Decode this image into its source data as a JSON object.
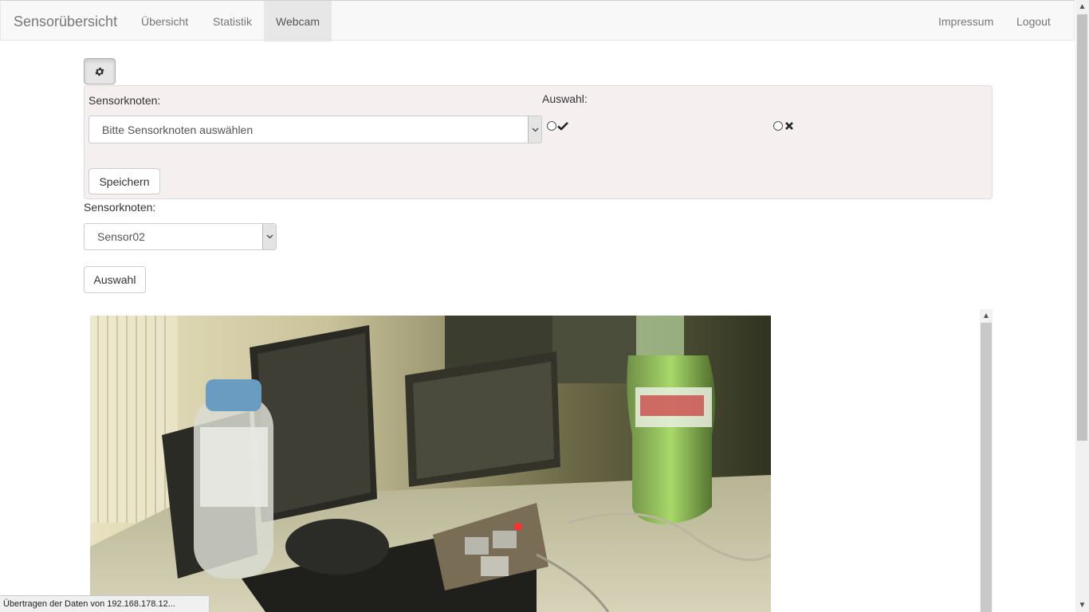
{
  "navbar": {
    "brand": "Sensorübersicht",
    "items": [
      {
        "label": "Übersicht",
        "active": false
      },
      {
        "label": "Statistik",
        "active": false
      },
      {
        "label": "Webcam",
        "active": true
      }
    ],
    "right_items": [
      {
        "label": "Impressum"
      },
      {
        "label": "Logout"
      }
    ]
  },
  "settings": {
    "gear_icon": "gear-icon",
    "panel": {
      "sensor_label": "Sensorknoten:",
      "sensor_select_value": "Bitte Sensorknoten auswählen",
      "choice_label": "Auswahl:",
      "options": [
        {
          "icon": "check-icon",
          "selected": false
        },
        {
          "icon": "cross-icon",
          "selected": false
        }
      ],
      "save_button": "Speichern"
    }
  },
  "selection": {
    "sensor_label": "Sensorknoten:",
    "sensor_select_value": "Sensor02",
    "submit_button": "Auswahl"
  },
  "webcam": {
    "image_description_hidden": ""
  },
  "statusbar": {
    "text": "Übertragen der Daten von 192.168.178.12..."
  },
  "colors": {
    "navbar_bg": "#f8f8f8",
    "panel_bg": "#f5eff0",
    "active_tab_bg": "#e7e7e7"
  }
}
